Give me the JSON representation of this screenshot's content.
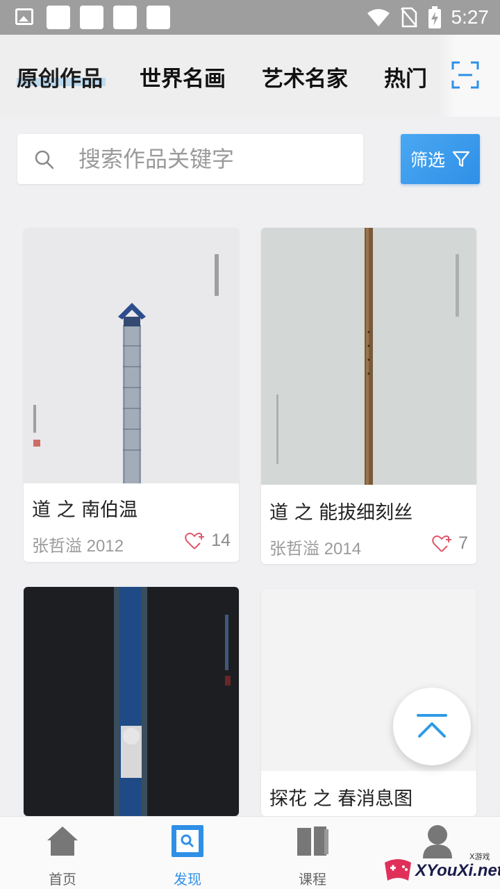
{
  "status_bar": {
    "time": "5:27"
  },
  "tabs": [
    {
      "label": "原创作品",
      "active": true
    },
    {
      "label": "世界名画",
      "active": false
    },
    {
      "label": "艺术名家",
      "active": false
    },
    {
      "label": "热门",
      "active": false
    }
  ],
  "search": {
    "placeholder": "搜索作品关键字",
    "value": ""
  },
  "filter": {
    "label": "筛选"
  },
  "cards": [
    {
      "title": "道 之 南伯温",
      "author_year": "张哲溢 2012",
      "likes": "14"
    },
    {
      "title": "道 之 能拔细刻丝",
      "author_year": "张哲溢 2014",
      "likes": "7"
    },
    {
      "title": "",
      "author_year": "",
      "likes": ""
    },
    {
      "title": "探花 之 春消息图",
      "author_year": "",
      "likes": ""
    }
  ],
  "bottom_nav": [
    {
      "label": "首页",
      "icon": "home-icon",
      "active": false
    },
    {
      "label": "发现",
      "icon": "discover-icon",
      "active": true
    },
    {
      "label": "课程",
      "icon": "course-icon",
      "active": false
    },
    {
      "label": "",
      "icon": "profile-icon",
      "active": false
    }
  ],
  "watermark": {
    "text": "XYouXi.net",
    "small": "X游戏"
  },
  "colors": {
    "accent": "#2f8fe6",
    "background": "#f0f0f2"
  }
}
